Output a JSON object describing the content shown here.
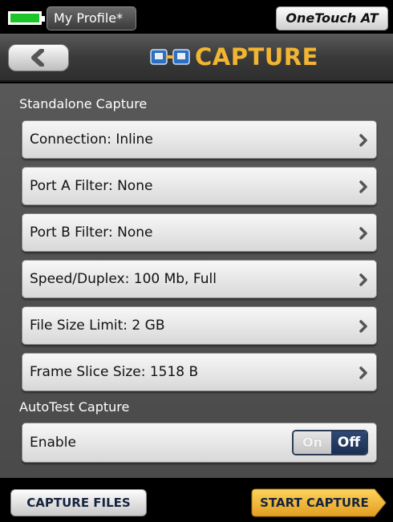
{
  "statusbar": {
    "profile_label": "My Profile*",
    "device_label": "OneTouch AT",
    "battery_color": "#1bc52a"
  },
  "header": {
    "title": "CAPTURE",
    "back_icon": "chevron-left-icon",
    "title_icon": "capture-icon",
    "title_color": "#f2b532"
  },
  "standalone": {
    "heading": "Standalone Capture",
    "items": [
      {
        "label": "Connection: Inline"
      },
      {
        "label": "Port A Filter: None"
      },
      {
        "label": "Port B Filter: None"
      },
      {
        "label": "Speed/Duplex: 100 Mb, Full"
      },
      {
        "label": "File Size Limit: 2 GB"
      },
      {
        "label": "Frame Slice Size: 1518 B"
      }
    ]
  },
  "autotest": {
    "heading": "AutoTest Capture",
    "enable_label": "Enable",
    "toggle_on": "On",
    "toggle_off": "Off",
    "toggle_state": "Off"
  },
  "footer": {
    "capture_files_label": "CAPTURE FILES",
    "start_capture_label": "START CAPTURE",
    "start_capture_color": "#f2b532"
  }
}
